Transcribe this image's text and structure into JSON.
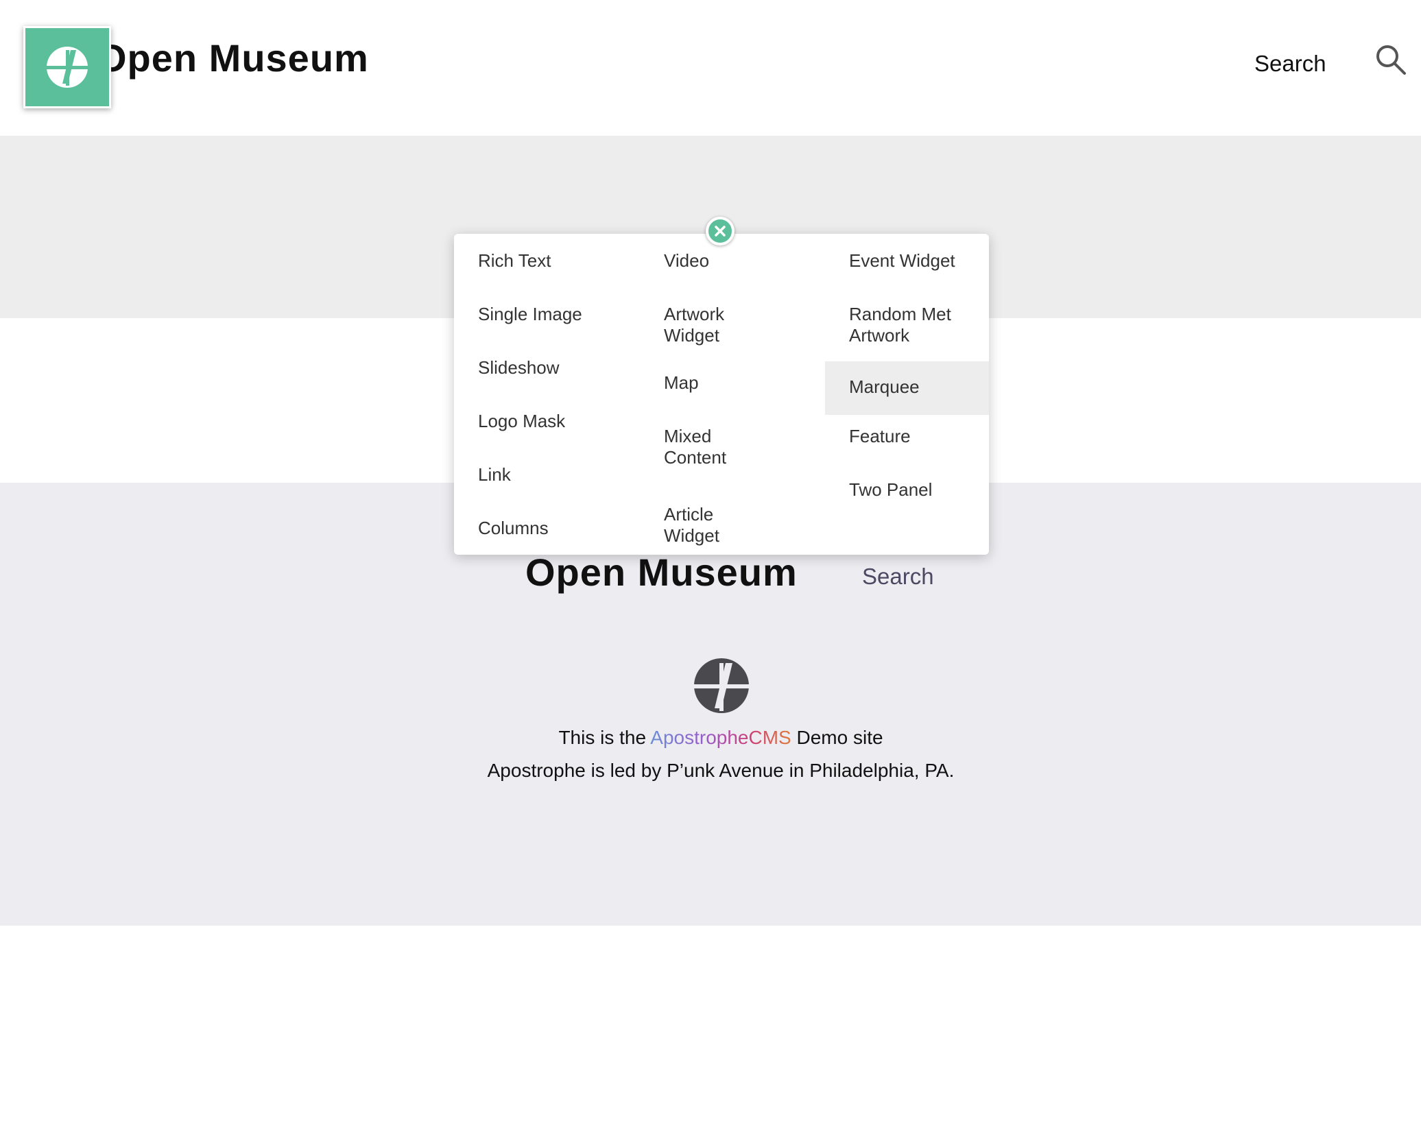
{
  "header": {
    "site_title": "Open Museum",
    "search_label": "Search",
    "search_icon": "search-icon",
    "admin_icon": "apostrophe-logo-icon"
  },
  "widget_menu": {
    "close_icon": "close-icon",
    "columns": [
      [
        "Rich Text",
        "Single Image",
        "Slideshow",
        "Logo Mask",
        "Link",
        "Columns"
      ],
      [
        "Video",
        "Artwork Widget",
        "Map",
        "Mixed Content",
        "Article Widget"
      ],
      [
        "Event Widget",
        "Random Met Artwork",
        "Marquee",
        "Feature",
        "Two Panel"
      ]
    ],
    "highlighted": "Marquee"
  },
  "footer": {
    "title": "Open Museum",
    "search_label": "Search",
    "logo_icon": "apostrophe-logo-icon",
    "line1_prefix": "This is the ",
    "line1_brand": "ApostropheCMS",
    "line1_suffix": " Demo site",
    "line2": "Apostrophe is led by P’unk Avenue in Philadelphia, PA."
  },
  "colors": {
    "accent": "#5bbf9c",
    "band_gray": "#ededed",
    "footer_bg": "#ededf1",
    "footer_search": "#4e4863"
  }
}
